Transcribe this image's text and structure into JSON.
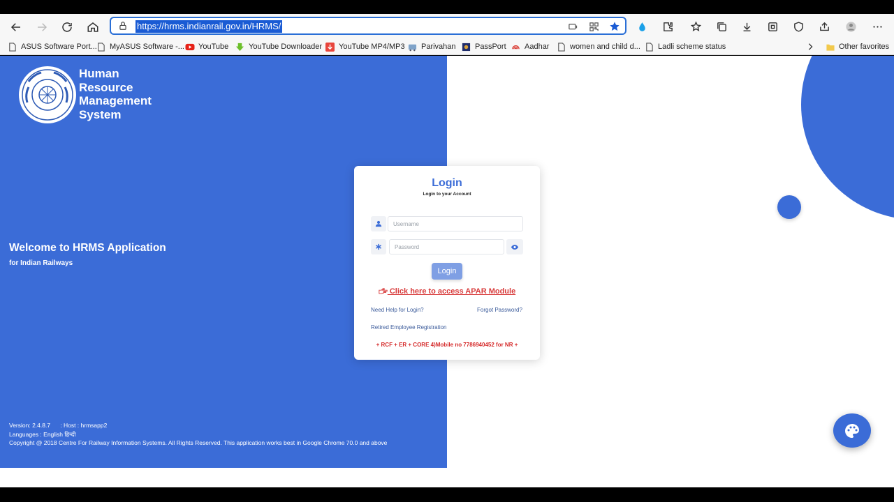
{
  "browser": {
    "url": "https://hrms.indianrail.gov.in/HRMS/",
    "bookmarks": [
      {
        "label": "ASUS Software Port...",
        "icon": "page-icon"
      },
      {
        "label": "MyASUS Software -...",
        "icon": "page-icon"
      },
      {
        "label": "YouTube",
        "icon": "youtube-icon"
      },
      {
        "label": "YouTube Downloader",
        "icon": "download-arrow-icon"
      },
      {
        "label": "YouTube MP4/MP3",
        "icon": "download-box-icon"
      },
      {
        "label": "Parivahan",
        "icon": "parivahan-icon"
      },
      {
        "label": "PassPort",
        "icon": "passport-icon"
      },
      {
        "label": "Aadhar",
        "icon": "aadhar-icon"
      },
      {
        "label": "women and child d...",
        "icon": "page-icon"
      },
      {
        "label": "Ladli scheme status",
        "icon": "page-icon"
      }
    ],
    "other_favorites": "Other favorites"
  },
  "brand": {
    "line1": "Human",
    "line2": "Resource",
    "line3": "Management",
    "line4": "System"
  },
  "welcome": {
    "title": "Welcome to HRMS Application",
    "subtitle": "for Indian Railways"
  },
  "footer": {
    "version": "Version: 2.4.8.7      : Host : hrmsapp2",
    "languages": "Languages : English हिन्दी",
    "copyright": "Copyright @ 2018 Centre For Railway Information Systems. All Rights Reserved. This application works best in Google Chrome 70.0 and above"
  },
  "login": {
    "title": "Login",
    "subtitle": "Login to your Account",
    "username_placeholder": "Username",
    "password_placeholder": "Password",
    "button": "Login",
    "apar_link": " Click here to access APAR Module",
    "help_link": "Need Help for Login?",
    "forgot_link": "Forgot Password?",
    "retired_link": "Retired Employee Registration",
    "marquee": "+ RCF + ER + CORE 4)Mobile no 7786940452 for NR +"
  },
  "colors": {
    "brand_blue": "#3b6cd7",
    "link_red": "#d83b3b"
  }
}
